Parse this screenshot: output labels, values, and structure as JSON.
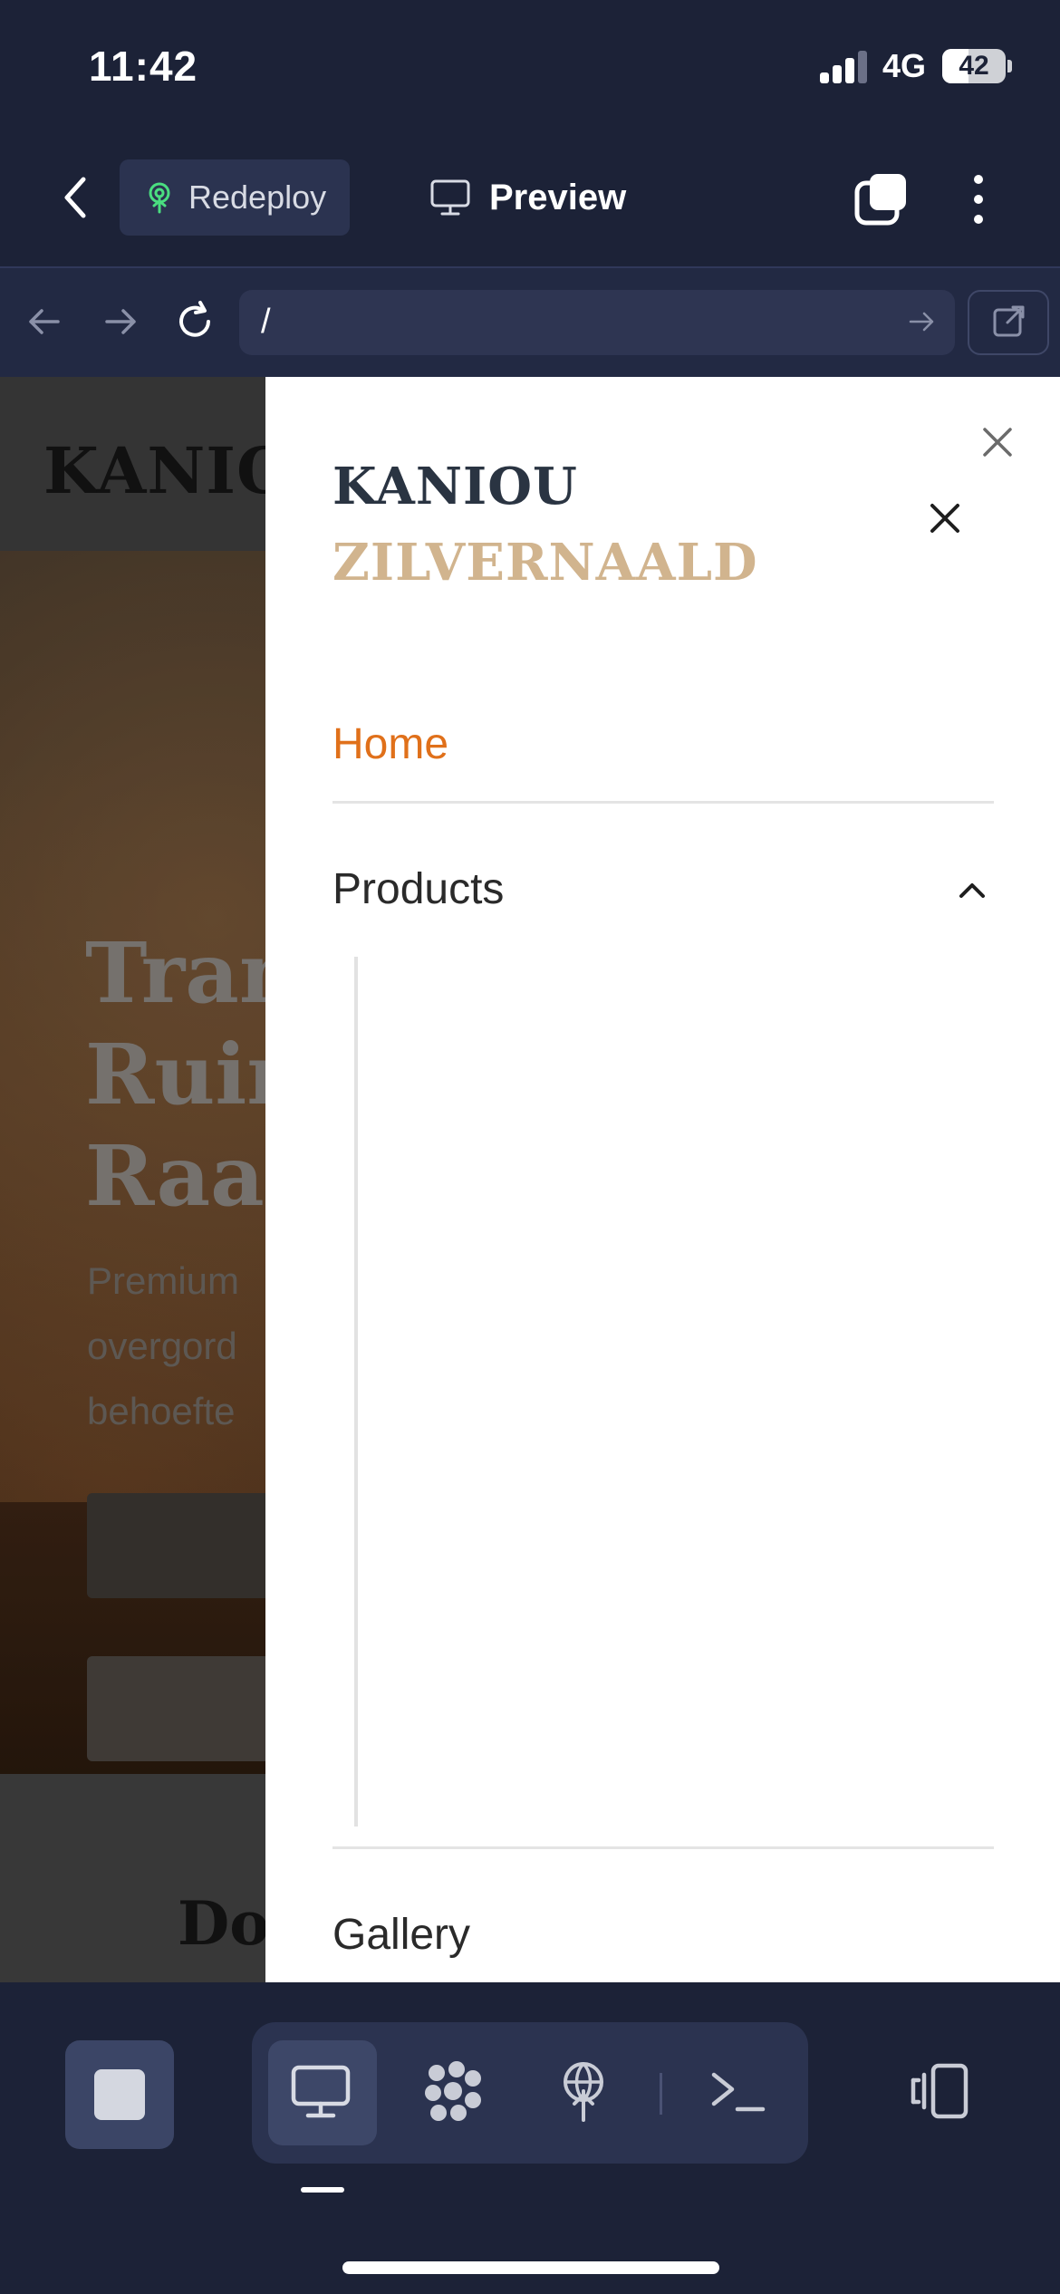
{
  "status_bar": {
    "time": "11:42",
    "network": "4G",
    "battery": "42",
    "battery_level": 0.42,
    "signal_bars_active": 3
  },
  "toolbar": {
    "back_icon": "chevron-left-icon",
    "redeploy_label": "Redeploy",
    "redeploy_icon": "deploy-tree-icon",
    "redeploy_icon_color": "#4ade80",
    "preview_label": "Preview",
    "preview_icon": "monitor-icon",
    "tabs_icon": "tabs-icon",
    "more_icon": "more-vertical-icon"
  },
  "browser": {
    "back_icon": "arrow-left-icon",
    "forward_icon": "arrow-right-icon",
    "reload_icon": "reload-icon",
    "url": "/",
    "go_icon": "arrow-right-icon",
    "open_external_icon": "external-link-icon"
  },
  "webpage": {
    "header_logo": "KANIOU",
    "hero_title": "Tran\nRuim\nRaan",
    "hero_subtitle": "Premium\novergord\nbehoefte",
    "section_title": "Do"
  },
  "drawer": {
    "brand_line1": "KANIOU",
    "brand_line2": "ZILVERNAALD",
    "brand_color1": "#2a3442",
    "brand_color2": "#d1b48e",
    "active_color": "#e0701a",
    "items": [
      {
        "label": "Home",
        "active": true
      },
      {
        "label": "Products",
        "expanded": true
      },
      {
        "label": "Gallery"
      }
    ]
  },
  "bottom_bar": {
    "stop_icon": "stop-icon",
    "tools": [
      "monitor-icon",
      "workflow-icon",
      "deploy-icon",
      "terminal-icon"
    ],
    "active_tool": "monitor-icon",
    "layout_icon": "panel-layout-icon"
  }
}
